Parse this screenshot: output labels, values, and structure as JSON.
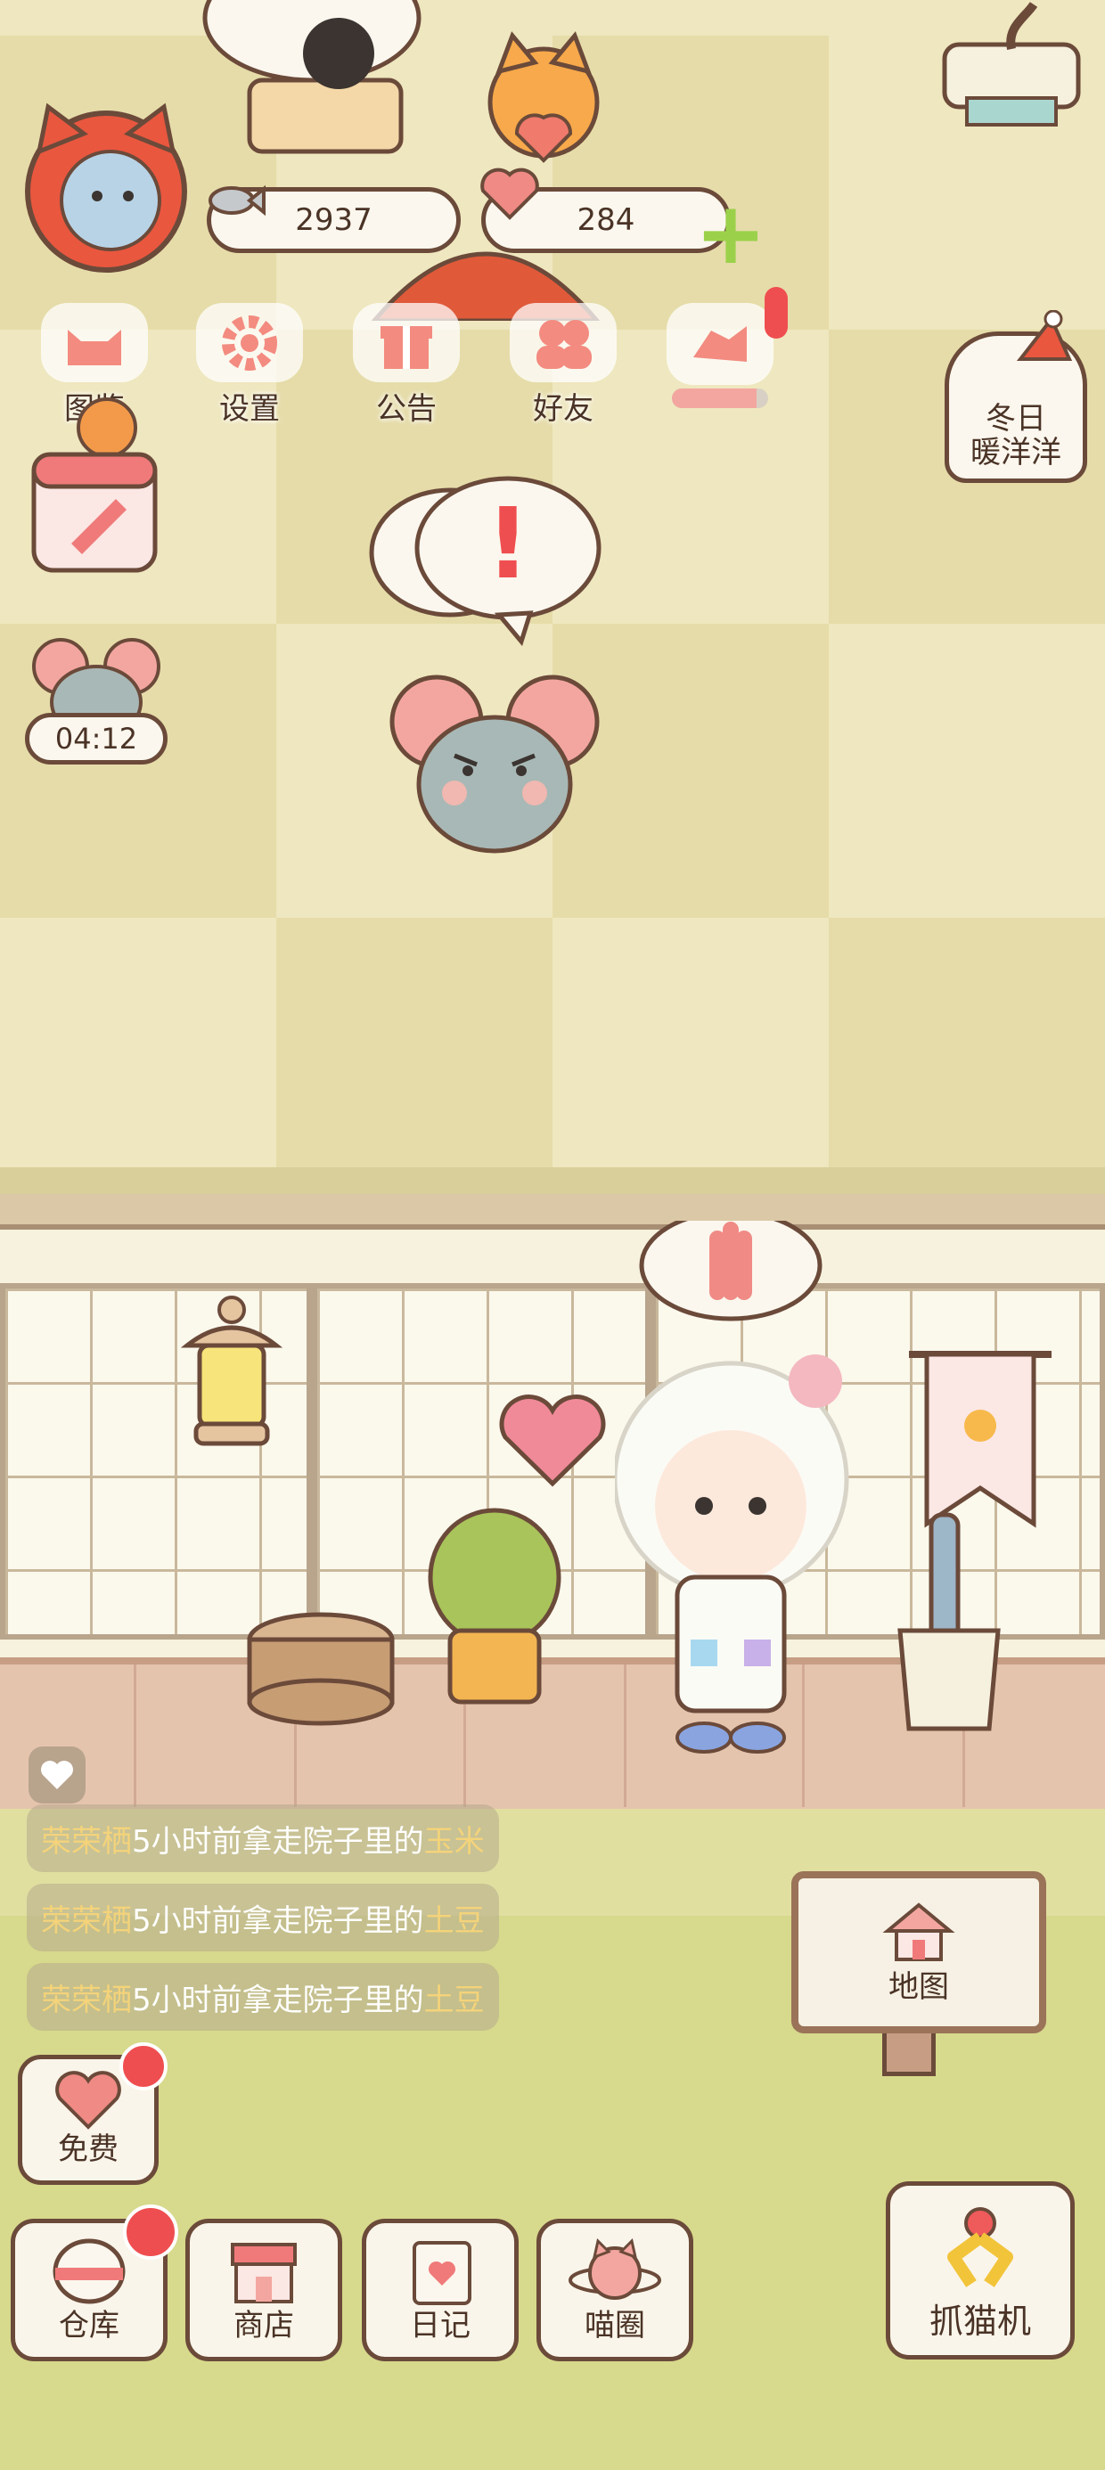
{
  "hud": {
    "currency_fish": "2937",
    "currency_hearts": "284",
    "add_symbol": "+"
  },
  "top_menu": [
    {
      "label": "图鉴",
      "icon": "cat-head-icon"
    },
    {
      "label": "设置",
      "icon": "gear-icon"
    },
    {
      "label": "公告",
      "icon": "gift-icon"
    },
    {
      "label": "好友",
      "icon": "friends-icon"
    },
    {
      "label": "",
      "icon": "like-hand-icon"
    }
  ],
  "event": {
    "line1": "冬日",
    "line2": "暖洋洋"
  },
  "mouse_timer": "04:12",
  "alert_mark": "!",
  "messages": [
    {
      "name": "荣荣栖",
      "action": "5小时前拿走院子里的",
      "item": "玉米"
    },
    {
      "name": "荣荣栖",
      "action": "5小时前拿走院子里的",
      "item": "土豆"
    },
    {
      "name": "荣荣栖",
      "action": "5小时前拿走院子里的",
      "item": "土豆"
    }
  ],
  "signboard": {
    "label": "地图"
  },
  "bottom": {
    "free": "免费",
    "warehouse": "仓库",
    "shop": "商店",
    "diary": "日记",
    "circle": "喵圈",
    "claw": "抓猫机"
  },
  "colors": {
    "accent": "#ef4e50",
    "ink": "#4a3326",
    "plus": "#9bd14a"
  }
}
